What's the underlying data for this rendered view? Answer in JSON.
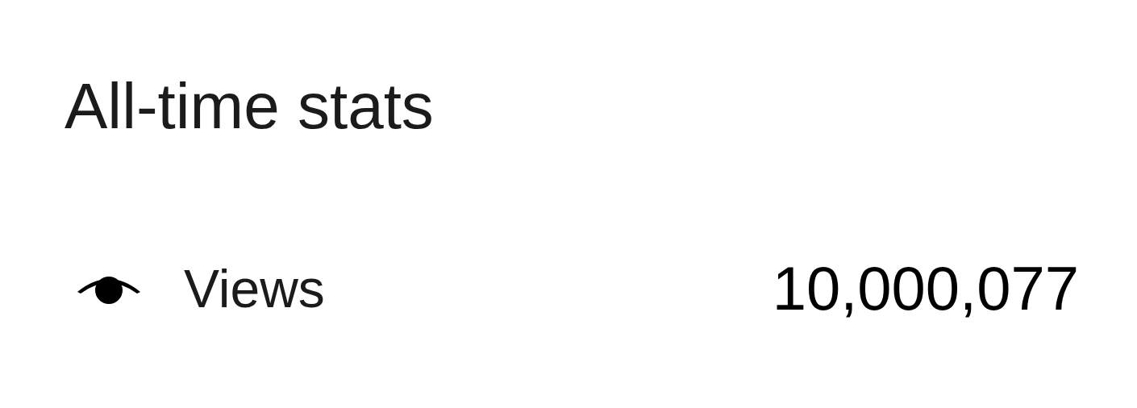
{
  "title": "All-time stats",
  "stats": [
    {
      "kind": "views",
      "label": "Views",
      "value": "10,000,077"
    }
  ]
}
